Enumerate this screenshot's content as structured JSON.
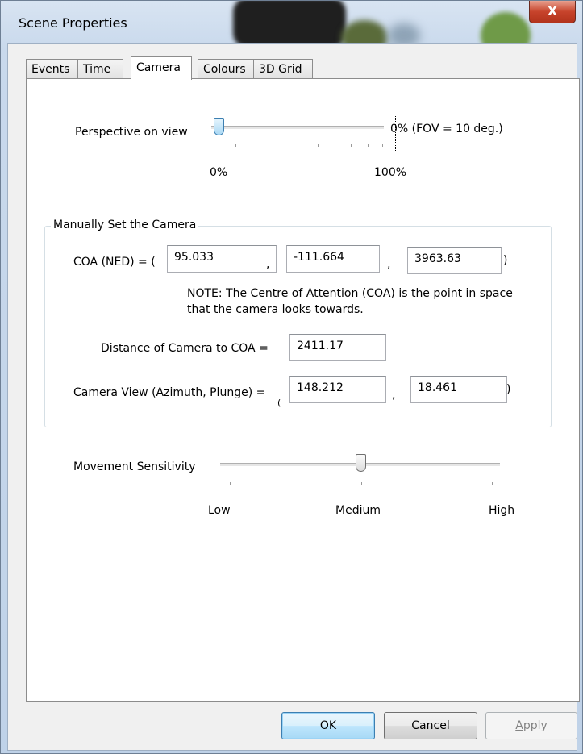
{
  "window": {
    "title": "Scene Properties",
    "close_glyph": "X"
  },
  "tabs": [
    "Events",
    "Time",
    "Camera",
    "Colours",
    "3D Grid"
  ],
  "active_tab": "Camera",
  "perspective": {
    "label": "Perspective on view",
    "value_text": "0% (FOV = 10 deg.)",
    "min_label": "0%",
    "max_label": "100%",
    "value": 0
  },
  "manual_camera": {
    "caption": "Manually Set the Camera",
    "coa_label": "COA (NED) = (",
    "coa_x": "95.033",
    "coa_y": "-111.664",
    "coa_z": "3963.63",
    "comma": ",",
    "close_paren": ")",
    "note_line1": "NOTE: The Centre of Attention (COA) is the point in space",
    "note_line2": "that the camera looks towards.",
    "distance_label": "Distance of Camera to COA =",
    "distance_value": "2411.17",
    "view_label": "Camera View (Azimuth, Plunge) =",
    "azimuth": "148.212",
    "plunge": "18.461"
  },
  "movement": {
    "label": "Movement Sensitivity",
    "low": "Low",
    "medium": "Medium",
    "high": "High",
    "value": 0.5
  },
  "buttons": {
    "ok": "OK",
    "cancel": "Cancel",
    "apply_first": "A",
    "apply_rest": "pply"
  },
  "colors": {
    "close": "#c7432b",
    "focus_blue": "#3c7fb1"
  }
}
